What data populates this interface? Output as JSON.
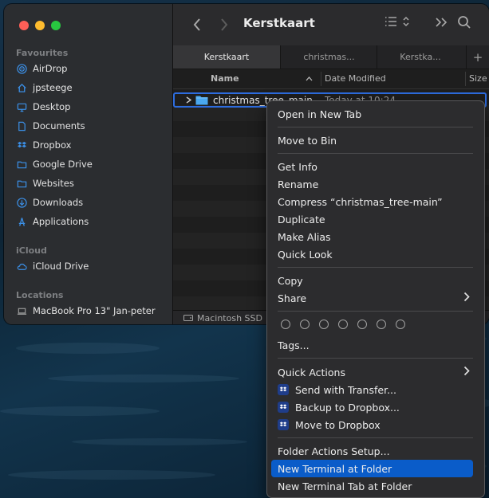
{
  "window": {
    "title": "Kerstkaart",
    "status_disk": "Macintosh SSD"
  },
  "sidebar": {
    "sections": [
      {
        "heading": "Favourites",
        "items": [
          {
            "label": "AirDrop",
            "icon": "airdrop-icon"
          },
          {
            "label": "jpsteege",
            "icon": "home-icon"
          },
          {
            "label": "Desktop",
            "icon": "desktop-icon"
          },
          {
            "label": "Documents",
            "icon": "document-icon"
          },
          {
            "label": "Dropbox",
            "icon": "dropbox-icon"
          },
          {
            "label": "Google Drive",
            "icon": "folder-icon"
          },
          {
            "label": "Websites",
            "icon": "folder-icon"
          },
          {
            "label": "Downloads",
            "icon": "download-icon"
          },
          {
            "label": "Applications",
            "icon": "applications-icon"
          }
        ]
      },
      {
        "heading": "iCloud",
        "items": [
          {
            "label": "iCloud Drive",
            "icon": "cloud-icon"
          }
        ]
      },
      {
        "heading": "Locations",
        "items": [
          {
            "label": "MacBook Pro 13\" Jan-peter",
            "icon": "laptop-icon"
          }
        ]
      }
    ]
  },
  "tabs": [
    {
      "label": "Kerstkaart",
      "active": true
    },
    {
      "label": "christmas...",
      "active": false
    },
    {
      "label": "Kerstka...",
      "active": false
    }
  ],
  "columns": {
    "name": "Name",
    "date_modified": "Date Modified",
    "size": "Size"
  },
  "file": {
    "name": "christmas_tree_main",
    "date": "Today at 10:24"
  },
  "menu": {
    "items": [
      {
        "label": "Open in New Tab"
      },
      {
        "label": "Move to Bin"
      },
      {
        "label": "Get Info"
      },
      {
        "label": "Rename"
      },
      {
        "label": "Compress “christmas_tree-main”"
      },
      {
        "label": "Duplicate"
      },
      {
        "label": "Make Alias"
      },
      {
        "label": "Quick Look"
      },
      {
        "label": "Copy"
      },
      {
        "label": "Share"
      },
      {
        "label": "Tags..."
      },
      {
        "label": "Quick Actions"
      },
      {
        "label": "Send with Transfer..."
      },
      {
        "label": "Backup to Dropbox..."
      },
      {
        "label": "Move to Dropbox"
      },
      {
        "label": "Folder Actions Setup..."
      },
      {
        "label": "New Terminal at Folder"
      },
      {
        "label": "New Terminal Tab at Folder"
      }
    ],
    "highlighted_index": 16,
    "tag_colors": [
      "none",
      "none",
      "none",
      "none",
      "none",
      "none",
      "none"
    ]
  },
  "colors": {
    "accent": "#0a5cc9",
    "selection_border": "#2d6cdf",
    "folder": "#4aa8f0"
  }
}
